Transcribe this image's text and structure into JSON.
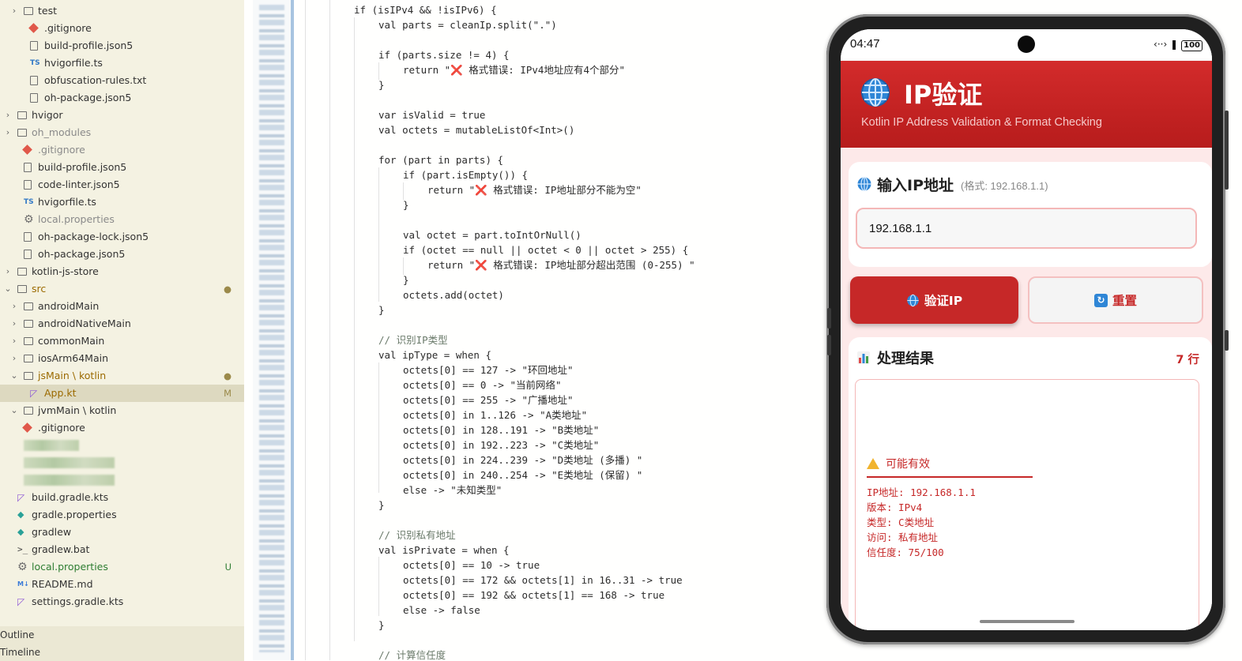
{
  "explorer": {
    "rows": [
      {
        "label": "test",
        "icon": "folder-icon",
        "chevron": "›",
        "color": "#333333"
      },
      {
        "label": ".gitignore",
        "icon": "git-icon",
        "color": "#333333"
      },
      {
        "label": "build-profile.json5",
        "icon": "file-icon",
        "color": "#333333"
      },
      {
        "label": "hvigorfile.ts",
        "icon": "ts-icon",
        "color": "#333333"
      },
      {
        "label": "obfuscation-rules.txt",
        "icon": "file-icon",
        "color": "#333333"
      },
      {
        "label": "oh-package.json5",
        "icon": "file-icon",
        "color": "#333333"
      },
      {
        "label": "hvigor",
        "icon": "folder-icon",
        "chevron": "›",
        "color": "#333333"
      },
      {
        "label": "oh_modules",
        "icon": "folder-icon",
        "chevron": "›",
        "color": "#8a8a8a"
      },
      {
        "label": ".gitignore",
        "icon": "git-icon",
        "color": "#8a8a8a"
      },
      {
        "label": "build-profile.json5",
        "icon": "file-icon",
        "color": "#333333"
      },
      {
        "label": "code-linter.json5",
        "icon": "file-icon",
        "color": "#333333"
      },
      {
        "label": "hvigorfile.ts",
        "icon": "ts-icon",
        "color": "#333333"
      },
      {
        "label": "local.properties",
        "icon": "gear-icon",
        "color": "#8a8a8a"
      },
      {
        "label": "oh-package-lock.json5",
        "icon": "file-icon",
        "color": "#333333"
      },
      {
        "label": "oh-package.json5",
        "icon": "file-icon",
        "color": "#333333"
      },
      {
        "label": "kotlin-js-store",
        "icon": "folder-icon",
        "chevron": "›",
        "color": "#333333"
      },
      {
        "label": "src",
        "icon": "folder-icon",
        "chevron": "⌄",
        "color": "#9b6a00",
        "badge": "●"
      },
      {
        "label": "androidMain",
        "icon": "folder-icon",
        "chevron": "›",
        "color": "#333333"
      },
      {
        "label": "androidNativeMain",
        "icon": "folder-icon",
        "chevron": "›",
        "color": "#333333"
      },
      {
        "label": "commonMain",
        "icon": "folder-icon",
        "chevron": "›",
        "color": "#333333"
      },
      {
        "label": "iosArm64Main",
        "icon": "folder-icon",
        "chevron": "›",
        "color": "#333333"
      },
      {
        "label": "jsMain \\ kotlin",
        "icon": "folder-icon",
        "chevron": "⌄",
        "color": "#9b6a00",
        "badge": "●"
      },
      {
        "label": "App.kt",
        "icon": "kotlin-icon",
        "color": "#9b6a00",
        "badge": "M",
        "selected": true
      },
      {
        "label": "jvmMain \\ kotlin",
        "icon": "folder-icon",
        "chevron": "⌄",
        "color": "#333333"
      },
      {
        "label": ".gitignore",
        "icon": "git-icon",
        "color": "#333333"
      },
      {
        "label": "",
        "icon": "blurred",
        "color": "#333333"
      },
      {
        "label": "",
        "icon": "blurred",
        "color": "#333333"
      },
      {
        "label": "",
        "icon": "blurred",
        "color": "#333333"
      },
      {
        "label": "build.gradle.kts",
        "icon": "kotlin-icon",
        "color": "#333333"
      },
      {
        "label": "gradle.properties",
        "icon": "elephant-icon",
        "color": "#333333"
      },
      {
        "label": "gradlew",
        "icon": "elephant-icon",
        "color": "#333333"
      },
      {
        "label": "gradlew.bat",
        "icon": "terminal-icon",
        "color": "#333333"
      },
      {
        "label": "local.properties",
        "icon": "gear-icon",
        "color": "#2e7d32",
        "badge": "U"
      },
      {
        "label": "README.md",
        "icon": "markdown-icon",
        "color": "#333333"
      },
      {
        "label": "settings.gradle.kts",
        "icon": "kotlin-icon",
        "color": "#333333"
      }
    ],
    "sections": [
      "Outline",
      "Timeline"
    ]
  },
  "code": {
    "lines": [
      {
        "indent": 0,
        "text": "if (isIPv4 && !isIPv6) {"
      },
      {
        "indent": 1,
        "text": "val parts = cleanIp.split(\".\")"
      },
      {
        "indent": 0,
        "text": ""
      },
      {
        "indent": 1,
        "text": "if (parts.size != 4) {"
      },
      {
        "indent": 2,
        "text": "return \"❌ 格式错误: IPv4地址应有4个部分\""
      },
      {
        "indent": 1,
        "text": "}"
      },
      {
        "indent": 0,
        "text": ""
      },
      {
        "indent": 1,
        "text": "var isValid = true"
      },
      {
        "indent": 1,
        "text": "val octets = mutableListOf<Int>()"
      },
      {
        "indent": 0,
        "text": ""
      },
      {
        "indent": 1,
        "text": "for (part in parts) {"
      },
      {
        "indent": 2,
        "text": "if (part.isEmpty()) {"
      },
      {
        "indent": 3,
        "text": "return \"❌ 格式错误: IP地址部分不能为空\""
      },
      {
        "indent": 2,
        "text": "}"
      },
      {
        "indent": 0,
        "text": ""
      },
      {
        "indent": 2,
        "text": "val octet = part.toIntOrNull()"
      },
      {
        "indent": 2,
        "text": "if (octet == null || octet < 0 || octet > 255) {"
      },
      {
        "indent": 3,
        "text": "return \"❌ 格式错误: IP地址部分超出范围 (0-255) \""
      },
      {
        "indent": 2,
        "text": "}"
      },
      {
        "indent": 2,
        "text": "octets.add(octet)"
      },
      {
        "indent": 1,
        "text": "}"
      },
      {
        "indent": 0,
        "text": ""
      },
      {
        "indent": 1,
        "text": "// 识别IP类型"
      },
      {
        "indent": 1,
        "text": "val ipType = when {"
      },
      {
        "indent": 2,
        "text": "octets[0] == 127 -> \"环回地址\""
      },
      {
        "indent": 2,
        "text": "octets[0] == 0 -> \"当前网络\""
      },
      {
        "indent": 2,
        "text": "octets[0] == 255 -> \"广播地址\""
      },
      {
        "indent": 2,
        "text": "octets[0] in 1..126 -> \"A类地址\""
      },
      {
        "indent": 2,
        "text": "octets[0] in 128..191 -> \"B类地址\""
      },
      {
        "indent": 2,
        "text": "octets[0] in 192..223 -> \"C类地址\""
      },
      {
        "indent": 2,
        "text": "octets[0] in 224..239 -> \"D类地址 (多播) \""
      },
      {
        "indent": 2,
        "text": "octets[0] in 240..254 -> \"E类地址 (保留) \""
      },
      {
        "indent": 2,
        "text": "else -> \"未知类型\""
      },
      {
        "indent": 1,
        "text": "}"
      },
      {
        "indent": 0,
        "text": ""
      },
      {
        "indent": 1,
        "text": "// 识别私有地址"
      },
      {
        "indent": 1,
        "text": "val isPrivate = when {"
      },
      {
        "indent": 2,
        "text": "octets[0] == 10 -> true"
      },
      {
        "indent": 2,
        "text": "octets[0] == 172 && octets[1] in 16..31 -> true"
      },
      {
        "indent": 2,
        "text": "octets[0] == 192 && octets[1] == 168 -> true"
      },
      {
        "indent": 2,
        "text": "else -> false"
      },
      {
        "indent": 1,
        "text": "}"
      },
      {
        "indent": 0,
        "text": ""
      },
      {
        "indent": 1,
        "text": "// 计算信任度"
      }
    ]
  },
  "phone": {
    "status": {
      "time": "04:47",
      "battery": "100",
      "icons": "‹··› ❚"
    },
    "header": {
      "title": "IP验证",
      "subtitle": "Kotlin IP Address Validation & Format Checking"
    },
    "input": {
      "label": "输入IP地址",
      "hint": "(格式: 192.168.1.1)",
      "value": "192.168.1.1"
    },
    "buttons": {
      "validate": "验证IP",
      "reset": "重置",
      "refresh_glyph": "↻"
    },
    "result": {
      "title": "处理结果",
      "count": "7 行",
      "status": "可能有效",
      "lines": [
        "IP地址: 192.168.1.1",
        "版本: IPv4",
        "类型: C类地址",
        "访问: 私有地址",
        "信任度: 75/100"
      ]
    },
    "colors": {
      "accent": "#c62828",
      "header_top": "#d32b2b",
      "content_bg": "#fde9e9",
      "input_border": "#f4b7b7"
    }
  }
}
